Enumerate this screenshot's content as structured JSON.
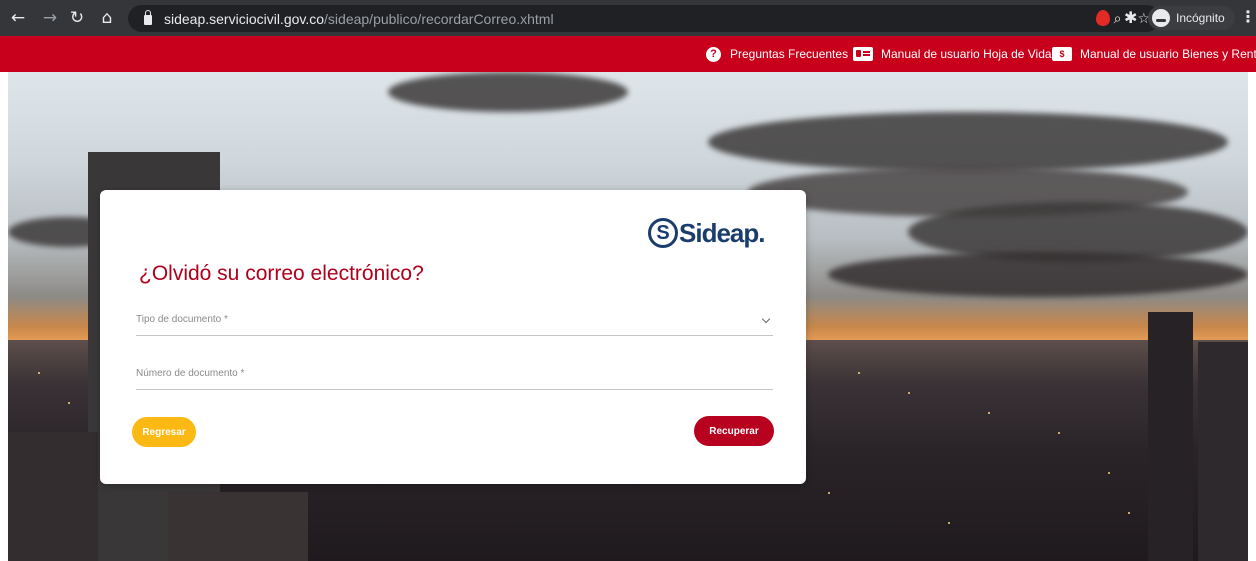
{
  "browser": {
    "url_host": "sideap.serviciocivil.gov.co",
    "url_path": "/sideap/publico/recordarCorreo.xhtml",
    "profile_label": "Incógnito",
    "icons": [
      "back-arrow-icon",
      "forward-arrow-icon",
      "reload-icon",
      "home-icon",
      "lock-icon",
      "zoom-icon",
      "star-icon",
      "extension-icon",
      "puzzle-icon",
      "incognito-icon",
      "menu-icon"
    ]
  },
  "topbar": {
    "links": [
      {
        "label": "Preguntas Frecuentes",
        "icon": "help-icon"
      },
      {
        "label": "Manual de usuario Hoja de Vida",
        "icon": "id-card-icon"
      },
      {
        "label": "Manual de usuario Bienes y Rentas",
        "icon": "money-icon"
      }
    ],
    "colors": {
      "bar": "#c8001b"
    }
  },
  "form": {
    "logo_text": "Sideap.",
    "title": "¿Olvidó su correo electrónico?",
    "document_type_label": "Tipo de documento *",
    "document_number_label": "Número de documento *",
    "back_label": "Regresar",
    "recover_label": "Recuperar",
    "colors": {
      "title": "#b0001c",
      "back_button": "#fdb913",
      "recover_button": "#b8001f"
    }
  }
}
